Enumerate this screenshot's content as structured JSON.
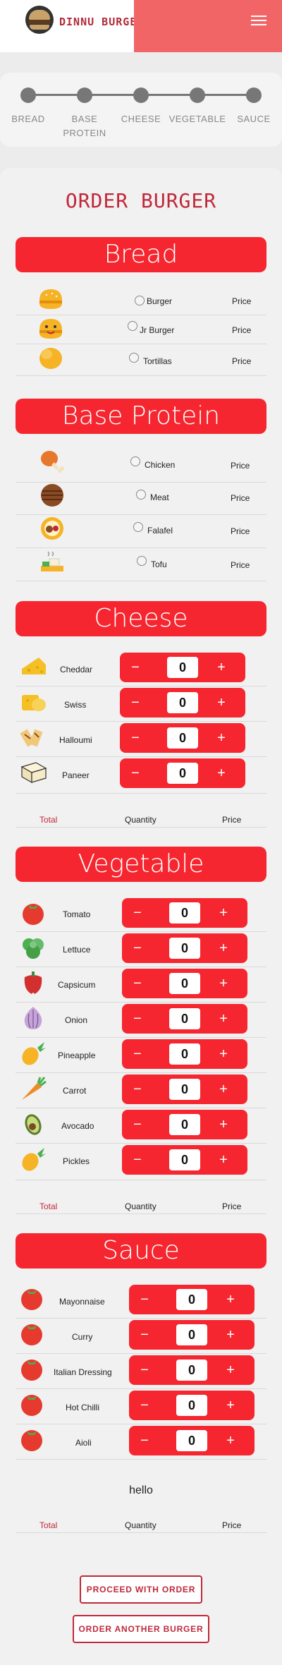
{
  "brand": "DINNU BURGER",
  "steps": [
    "BREAD",
    "BASE PROTEIN",
    "CHEESE",
    "VEGETABLE",
    "SAUCE"
  ],
  "order_title": "ORDER BURGER",
  "bread": {
    "title": "Bread",
    "items": [
      {
        "name": "Burger",
        "price_label": "Price",
        "icon": "burger-bun-icon"
      },
      {
        "name": "Jr Burger",
        "price_label": "Price",
        "icon": "jr-burger-icon"
      },
      {
        "name": "Tortillas",
        "price_label": "Price",
        "icon": "tortilla-icon"
      }
    ]
  },
  "base_protein": {
    "title": "Base Protein",
    "items": [
      {
        "name": "Chicken",
        "price_label": "Price",
        "icon": "chicken-leg-icon"
      },
      {
        "name": "Meat",
        "price_label": "Price",
        "icon": "meat-patty-icon"
      },
      {
        "name": "Falafel",
        "price_label": "Price",
        "icon": "falafel-icon"
      },
      {
        "name": "Tofu",
        "price_label": "Price",
        "icon": "tofu-icon"
      }
    ]
  },
  "cheese": {
    "title": "Cheese",
    "items": [
      {
        "name": "Cheddar",
        "qty": "0",
        "icon": "cheddar-icon"
      },
      {
        "name": "Swiss",
        "qty": "0",
        "icon": "swiss-cheese-icon"
      },
      {
        "name": "Halloumi",
        "qty": "0",
        "icon": "halloumi-icon"
      },
      {
        "name": "Paneer",
        "qty": "0",
        "icon": "paneer-icon"
      }
    ],
    "total": {
      "total": "Total",
      "quantity": "Quantity",
      "price": "Price"
    }
  },
  "vegetable": {
    "title": "Vegetable",
    "items": [
      {
        "name": "Tomato",
        "qty": "0",
        "icon": "tomato-icon"
      },
      {
        "name": "Lettuce",
        "qty": "0",
        "icon": "lettuce-icon"
      },
      {
        "name": "Capsicum",
        "qty": "0",
        "icon": "capsicum-icon"
      },
      {
        "name": "Onion",
        "qty": "0",
        "icon": "onion-icon"
      },
      {
        "name": "Pineapple",
        "qty": "0",
        "icon": "pineapple-icon"
      },
      {
        "name": "Carrot",
        "qty": "0",
        "icon": "carrot-icon"
      },
      {
        "name": "Avocado",
        "qty": "0",
        "icon": "avocado-icon"
      },
      {
        "name": "Pickles",
        "qty": "0",
        "icon": "pickles-icon"
      }
    ],
    "total": {
      "total": "Total",
      "quantity": "Quantity",
      "price": "Price"
    }
  },
  "sauce": {
    "title": "Sauce",
    "items": [
      {
        "name": "Mayonnaise",
        "qty": "0",
        "icon": "tomato-icon"
      },
      {
        "name": "Curry",
        "qty": "0",
        "icon": "tomato-icon"
      },
      {
        "name": "Italian Dressing",
        "qty": "0",
        "icon": "tomato-icon"
      },
      {
        "name": "Hot Chilli",
        "qty": "0",
        "icon": "tomato-icon"
      },
      {
        "name": "Aioli",
        "qty": "0",
        "icon": "tomato-icon"
      }
    ],
    "note": "hello",
    "total": {
      "total": "Total",
      "quantity": "Quantity",
      "price": "Price"
    }
  },
  "stepper_symbols": {
    "minus": "−",
    "plus": "+"
  },
  "buttons": {
    "proceed": "PROCEED WITH ORDER",
    "another": "ORDER ANOTHER BURGER"
  },
  "colors": {
    "accent": "#f5262f",
    "brand_red": "#c0283a",
    "header_pink": "#f26567"
  }
}
